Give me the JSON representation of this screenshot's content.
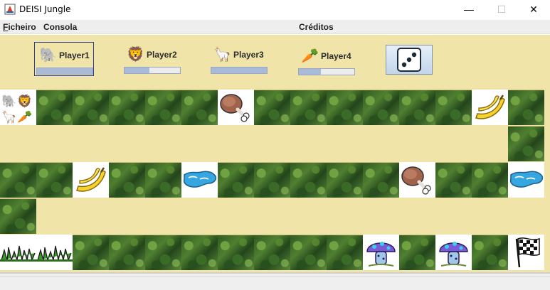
{
  "window": {
    "title": "DEISI Jungle",
    "minimize": "—",
    "maximize": "☐",
    "close": "✕"
  },
  "menu": [
    {
      "mnemonic": "F",
      "rest": "icheiro"
    },
    {
      "mnemonic": "",
      "rest": "Consola"
    },
    {
      "mnemonic": "",
      "rest": "Créditos"
    }
  ],
  "players": [
    {
      "name": "Player1",
      "avatar": "🐘",
      "icon": "elephant-icon",
      "energy": 1.0,
      "active": true
    },
    {
      "name": "Player2",
      "avatar": "🦁",
      "icon": "lion-icon",
      "energy": 0.45
    },
    {
      "name": "Player3",
      "avatar": "🦙",
      "icon": "llama-icon",
      "energy": 1.0
    },
    {
      "name": "Player4",
      "avatar": "🥕",
      "icon": "carrot-icon",
      "energy": 0.4
    }
  ],
  "dice": {
    "icon": "dice-icon",
    "face": 3
  },
  "board": {
    "row1": [
      "players",
      "jungle",
      "jungle",
      "jungle",
      "jungle",
      "jungle",
      "meat",
      "jungle",
      "jungle",
      "jungle",
      "jungle",
      "jungle",
      "jungle",
      "banana",
      "jungle"
    ],
    "col_right": [
      "jungle"
    ],
    "row2": [
      "jungle",
      "jungle",
      "banana",
      "jungle",
      "jungle",
      "water",
      "jungle",
      "jungle",
      "jungle",
      "jungle",
      "jungle",
      "meat",
      "jungle",
      "jungle",
      "water"
    ],
    "col_left": [
      "jungle"
    ],
    "row3": [
      "grass",
      "grass",
      "jungle",
      "jungle",
      "jungle",
      "jungle",
      "jungle",
      "jungle",
      "jungle",
      "jungle",
      "mushroom",
      "jungle",
      "mushroom",
      "jungle",
      "finish"
    ]
  }
}
